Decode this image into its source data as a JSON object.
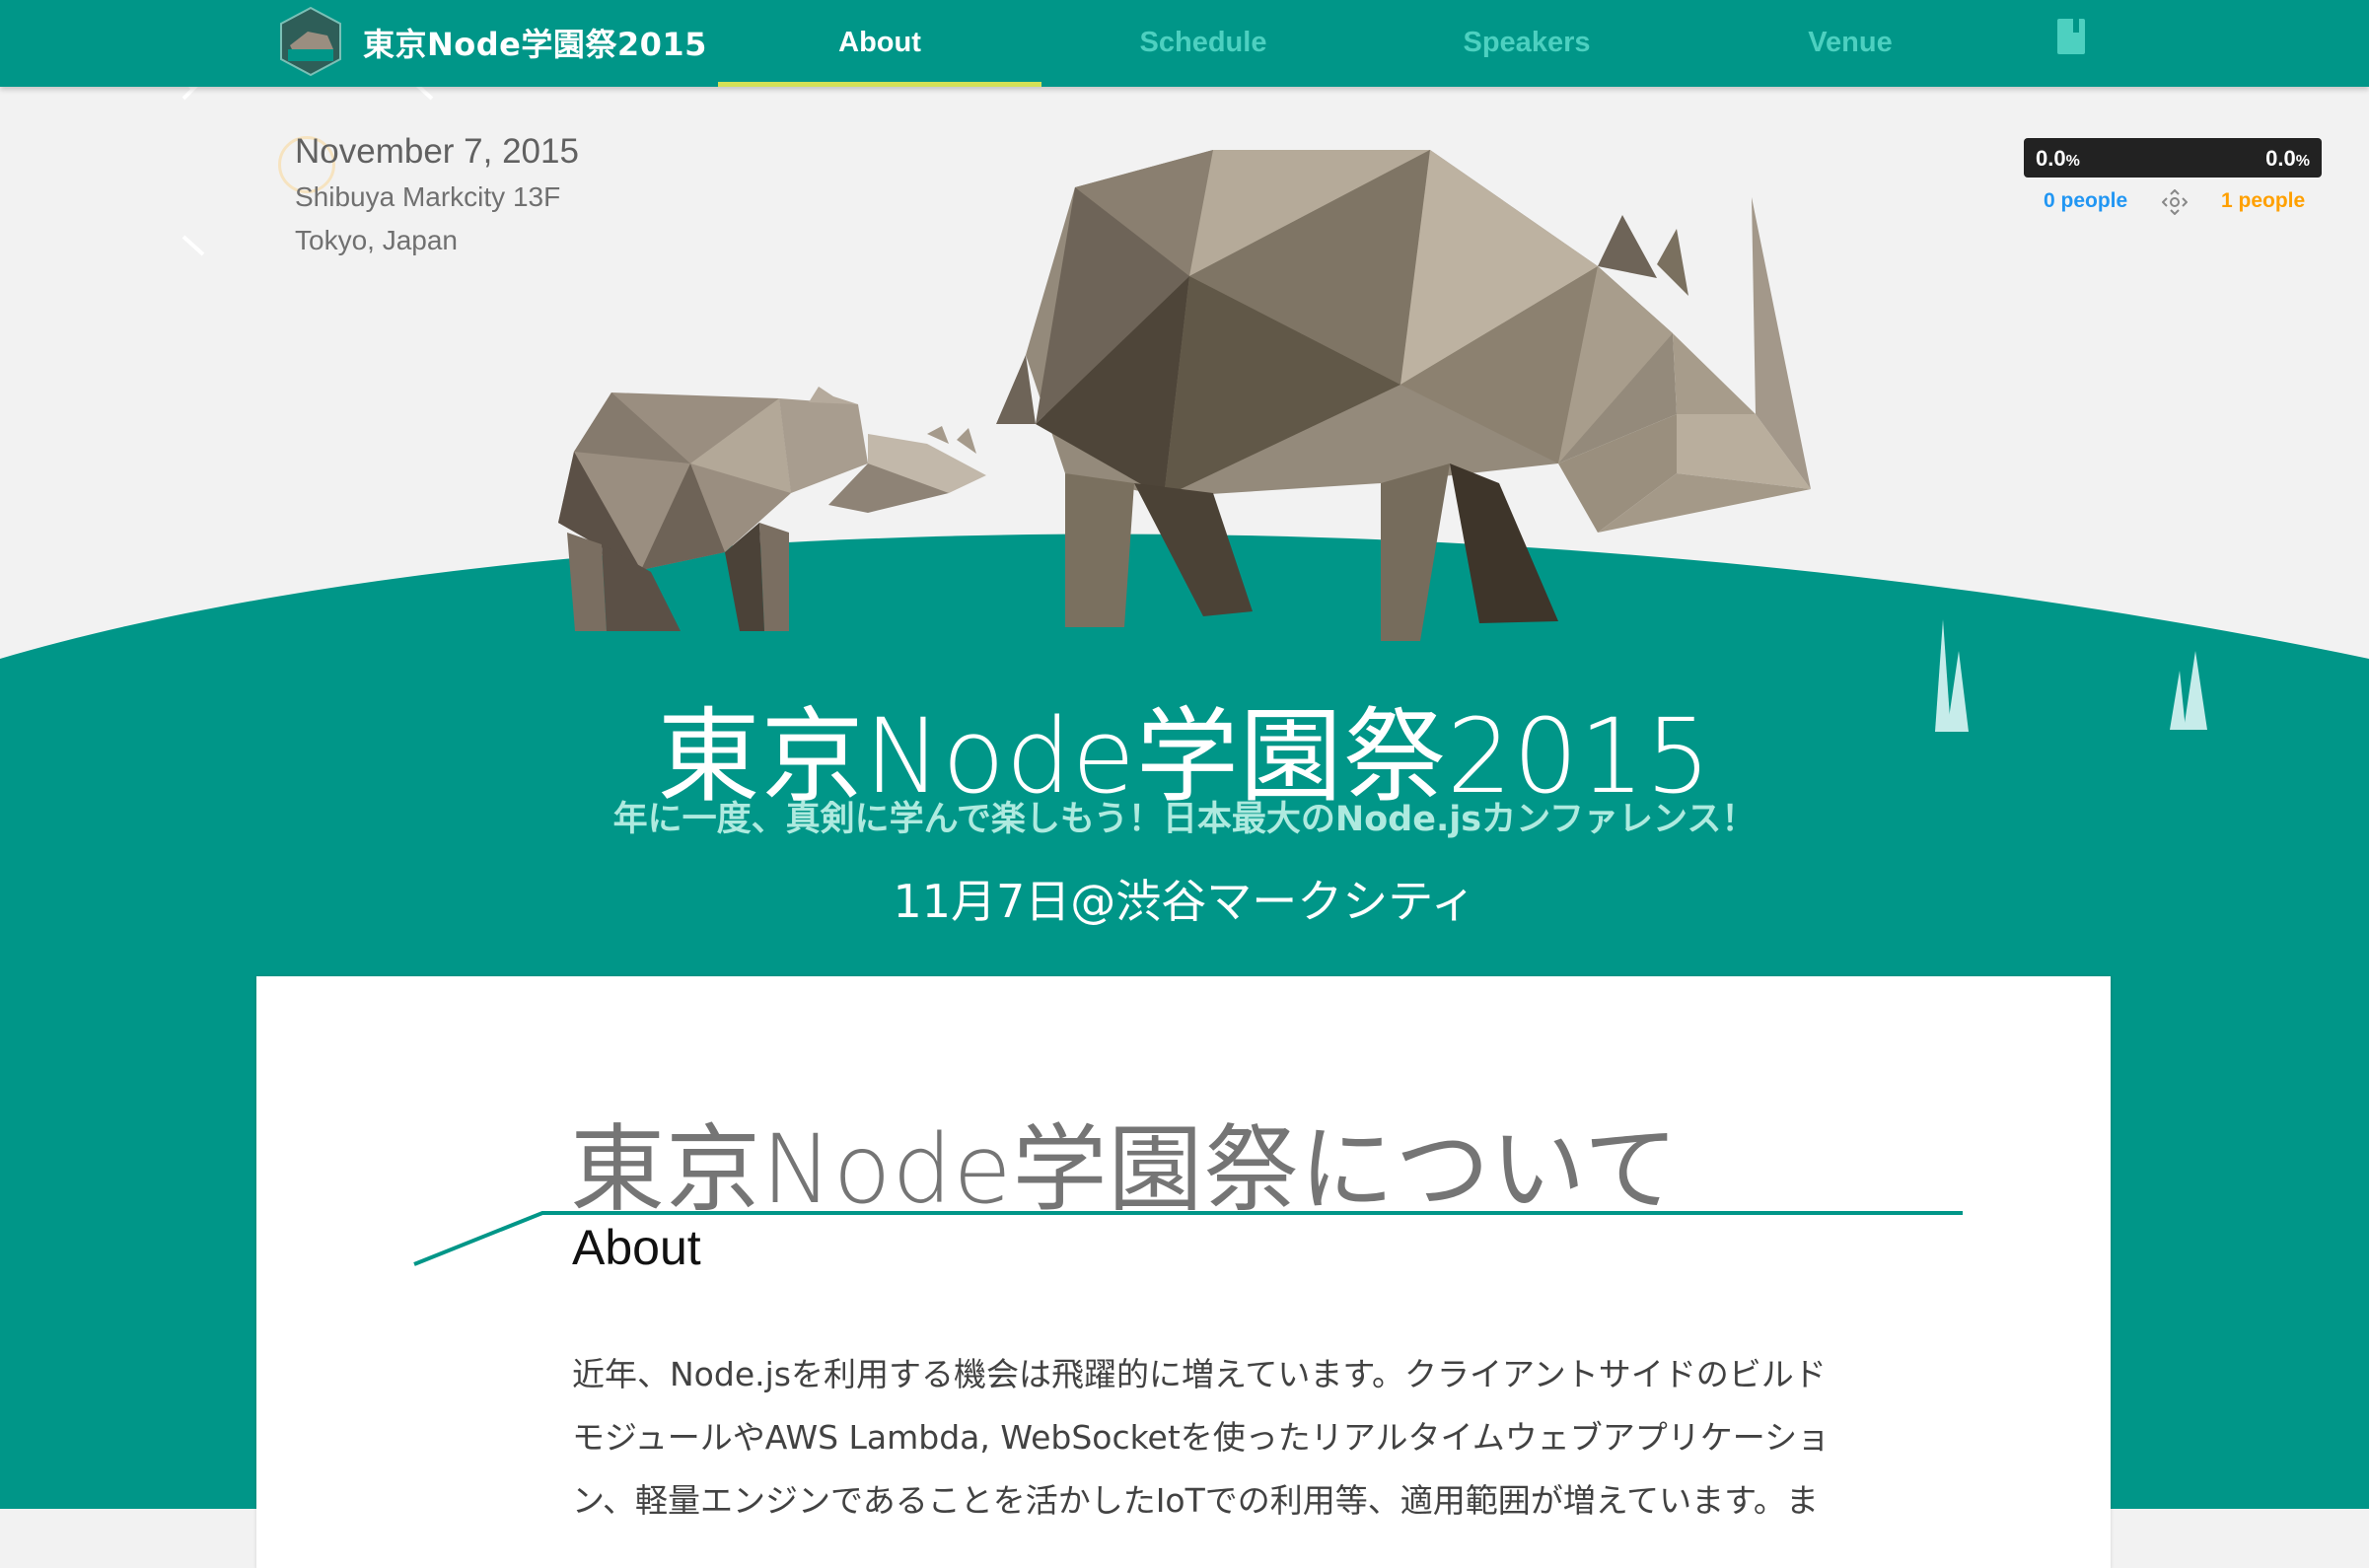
{
  "header": {
    "brand": "東京Node学園祭2015",
    "nav": [
      {
        "label": "About",
        "active": true
      },
      {
        "label": "Schedule",
        "active": false
      },
      {
        "label": "Speakers",
        "active": false
      },
      {
        "label": "Venue",
        "active": false
      }
    ],
    "icons": [
      "logo-badge-icon",
      "book-icon"
    ]
  },
  "event": {
    "date": "November 7, 2015",
    "place": "Shibuya Markcity 13F",
    "city": "Tokyo, Japan"
  },
  "hero": {
    "title": "東京Node学園祭2015",
    "tagline": "年に一度、真剣に学んで楽しもう！日本最大のNode.jsカンファレンス！",
    "when": "11月7日@渋谷マークシティ"
  },
  "widget": {
    "left_percent": "0.0",
    "right_percent": "0.0",
    "percent_suffix": "%",
    "left_people": "0 people",
    "right_people": "1 people"
  },
  "about": {
    "heading": "東京Node学園祭について",
    "subheading": "About",
    "lines": [
      "近年、Node.jsを利用する機会は飛躍的に増えています。クライアントサイドのビルド",
      "モジュールやAWS Lambda, WebSocketを使ったリアルタイムウェブアプリケーショ",
      "ン、軽量エンジンであることを活かしたIoTでの利用等、適用範囲が増えています。ま"
    ]
  },
  "colors": {
    "primary": "#009688",
    "nav_active_underline": "#d4e157",
    "nav_inactive_text": "#4dd0c0",
    "tagline": "#aeeadf",
    "people_left": "#2196f3",
    "people_right": "#ffa000",
    "page_bg": "#f2f2f2"
  }
}
